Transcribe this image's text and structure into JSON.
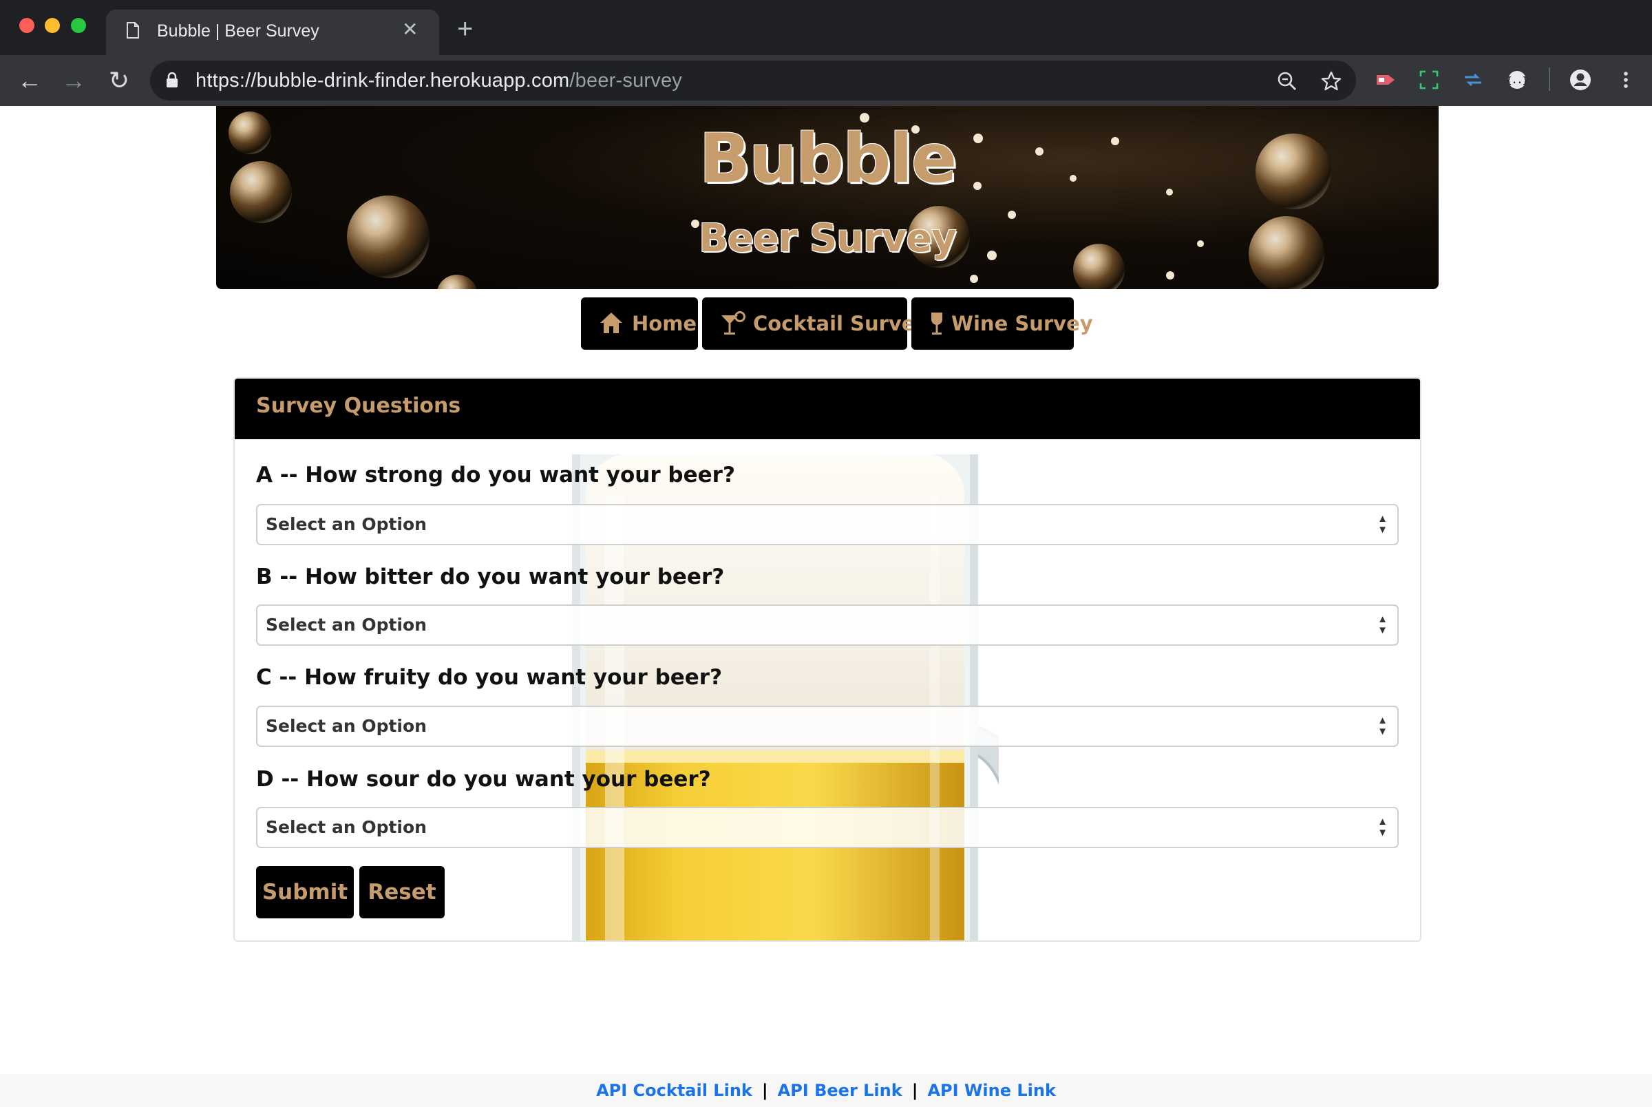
{
  "browser": {
    "tab_title": "Bubble | Beer Survey",
    "url_host": "https://bubble-drink-finder.herokuapp.com",
    "url_path": "/beer-survey"
  },
  "banner": {
    "title": "Bubble",
    "subtitle": "Beer Survey"
  },
  "nav": {
    "home": "Home",
    "cocktail": "Cocktail Survey",
    "wine": "Wine Survey"
  },
  "survey": {
    "header": "Survey Questions",
    "questions": [
      {
        "label": "A -- How strong do you want your beer?",
        "selected": "Select an Option"
      },
      {
        "label": "B -- How bitter do you want your beer?",
        "selected": "Select an Option"
      },
      {
        "label": "C -- How fruity do you want your beer?",
        "selected": "Select an Option"
      },
      {
        "label": "D -- How sour do you want your beer?",
        "selected": "Select an Option"
      }
    ],
    "submit_label": "Submit",
    "reset_label": "Reset"
  },
  "footer": {
    "cocktail_link": "API Cocktail Link",
    "beer_link": "API Beer Link",
    "wine_link": "API Wine Link",
    "separator": "|"
  },
  "colors": {
    "accent": "#c69c6d",
    "dark": "#000000",
    "link": "#1a73e8"
  }
}
